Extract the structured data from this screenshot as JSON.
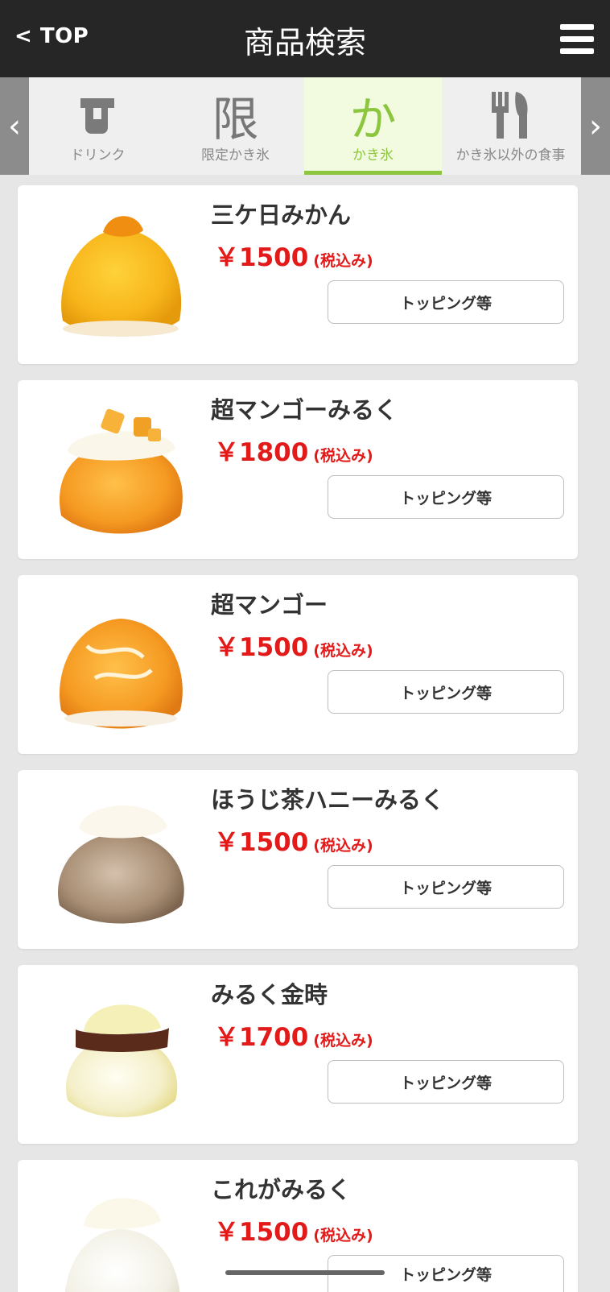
{
  "header": {
    "back_label": "< TOP",
    "title": "商品検索",
    "menu_icon": "hamburger-menu-icon"
  },
  "tabs": {
    "prev_arrow": "‹",
    "next_arrow": "›",
    "items": [
      {
        "label": "ドリンク",
        "icon": "cup-icon",
        "active": false
      },
      {
        "label": "限定かき氷",
        "glyph": "限",
        "active": false
      },
      {
        "label": "かき氷",
        "glyph": "か",
        "active": true
      },
      {
        "label": "かき氷以外の食事",
        "icon": "fork-knife-icon",
        "active": false
      }
    ],
    "active_color": "#8cc63f"
  },
  "products": [
    {
      "name": "三ケ日みかん",
      "price": "￥1500",
      "tax": "(税込み)",
      "button": "トッピング等",
      "image": "orange-shaved-ice"
    },
    {
      "name": "超マンゴーみるく",
      "price": "￥1800",
      "tax": "(税込み)",
      "button": "トッピング等",
      "image": "mango-milk-shaved-ice"
    },
    {
      "name": "超マンゴー",
      "price": "￥1500",
      "tax": "(税込み)",
      "button": "トッピング等",
      "image": "mango-shaved-ice"
    },
    {
      "name": "ほうじ茶ハニーみるく",
      "price": "￥1500",
      "tax": "(税込み)",
      "button": "トッピング等",
      "image": "hojicha-shaved-ice"
    },
    {
      "name": "みるく金時",
      "price": "￥1700",
      "tax": "(税込み)",
      "button": "トッピング等",
      "image": "milk-kintoki-shaved-ice"
    },
    {
      "name": "これがみるく",
      "price": "￥1500",
      "tax": "(税込み)",
      "button": "トッピング等",
      "image": "milk-shaved-ice"
    }
  ],
  "colors": {
    "header_bg": "#262626",
    "price": "#e21a1a"
  }
}
